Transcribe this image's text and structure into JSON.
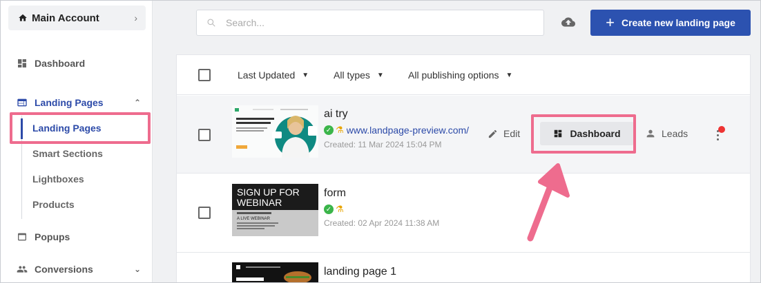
{
  "sidebar": {
    "account": "Main Account",
    "items": [
      {
        "label": "Dashboard",
        "icon": "dashboard-icon"
      },
      {
        "label": "Landing Pages",
        "icon": "web-icon"
      },
      {
        "label": "Popups",
        "icon": "popup-icon"
      },
      {
        "label": "Conversions",
        "icon": "people-icon"
      }
    ],
    "sub_items": [
      "Landing Pages",
      "Smart Sections",
      "Lightboxes",
      "Products"
    ]
  },
  "topbar": {
    "search_placeholder": "Search...",
    "create_button": "Create new landing page"
  },
  "toolbar": {
    "filters": [
      "Last Updated",
      "All types",
      "All publishing options"
    ]
  },
  "rows": [
    {
      "title": "ai try",
      "url": "www.landpage-preview.com/",
      "created": "Created: 11 Mar 2024 15:04 PM"
    },
    {
      "title": "form",
      "url": "",
      "created": "Created: 02 Apr 2024 11:38 AM"
    },
    {
      "title": "landing page 1",
      "url": "",
      "created": ""
    }
  ],
  "actions": {
    "edit": "Edit",
    "dashboard": "Dashboard",
    "leads": "Leads"
  },
  "thumb2": {
    "line1": "SIGN UP FOR",
    "line2": "WEBINAR",
    "line3": "A LIVE WEBINAR"
  },
  "colors": {
    "accent": "#2c52b0",
    "highlight": "#ee6c8e",
    "success": "#3bb54a"
  }
}
